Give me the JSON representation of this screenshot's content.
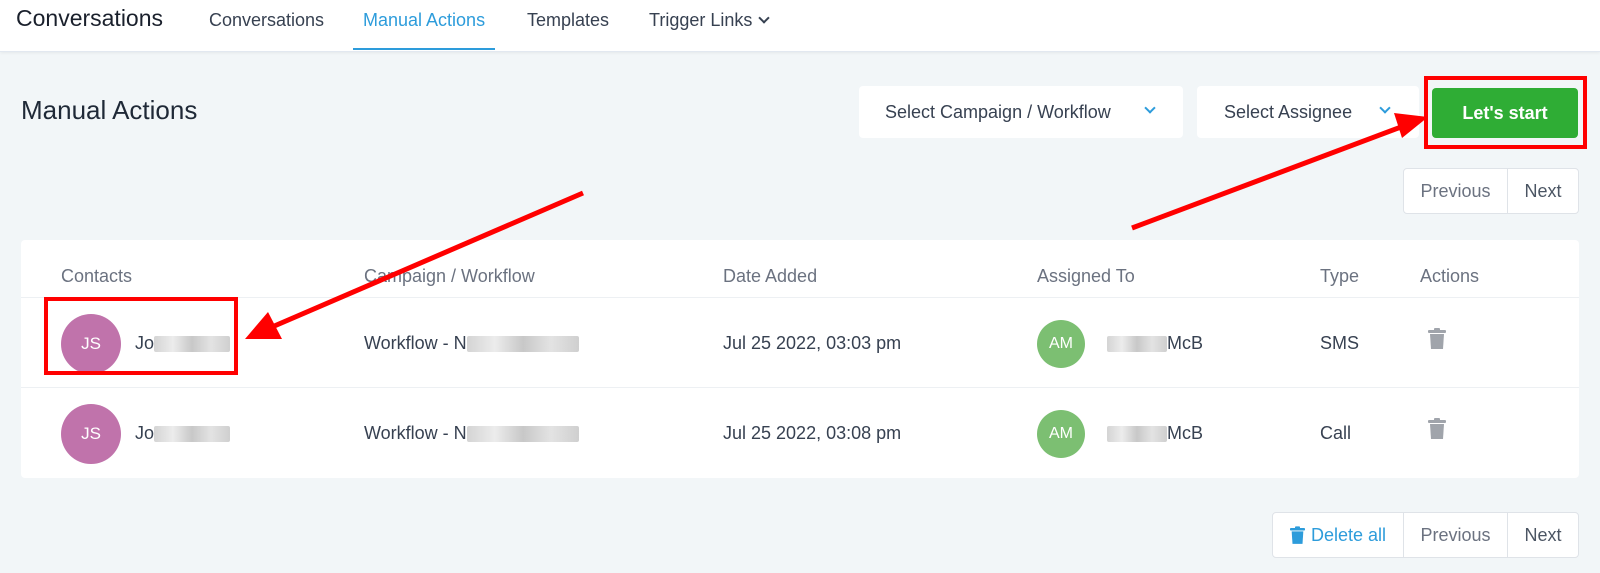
{
  "header": {
    "brand": "Conversations",
    "tabs": [
      {
        "label": "Conversations"
      },
      {
        "label": "Manual Actions"
      },
      {
        "label": "Templates"
      },
      {
        "label": "Trigger Links"
      }
    ]
  },
  "page": {
    "title": "Manual Actions",
    "campaign_select": "Select Campaign / Workflow",
    "assignee_select": "Select Assignee",
    "start_button": "Let's start"
  },
  "pager_top": {
    "previous": "Previous",
    "next": "Next"
  },
  "pager_bottom": {
    "delete_all": "Delete all",
    "previous": "Previous",
    "next": "Next"
  },
  "table": {
    "columns": [
      "Contacts",
      "Campaign / Workflow",
      "Date Added",
      "Assigned To",
      "Type",
      "Actions"
    ],
    "rows": [
      {
        "contact_initials": "JS",
        "contact_name": "Jo",
        "workflow": "Workflow - N",
        "date": "Jul 25 2022, 03:03 pm",
        "assignee_initials": "AM",
        "assignee_name": "McB",
        "type": "SMS"
      },
      {
        "contact_initials": "JS",
        "contact_name": "Jo",
        "workflow": "Workflow - N",
        "date": "Jul 25 2022, 03:08 pm",
        "assignee_initials": "AM",
        "assignee_name": "McB",
        "type": "Call"
      }
    ]
  },
  "colors": {
    "accent": "#2d9cdb",
    "start": "#2fad35",
    "highlight": "#ff0000",
    "contact_avatar": "#c073ab",
    "assignee_avatar": "#7cbf72"
  },
  "icons": [
    "chevron-down-icon",
    "trash-icon"
  ]
}
